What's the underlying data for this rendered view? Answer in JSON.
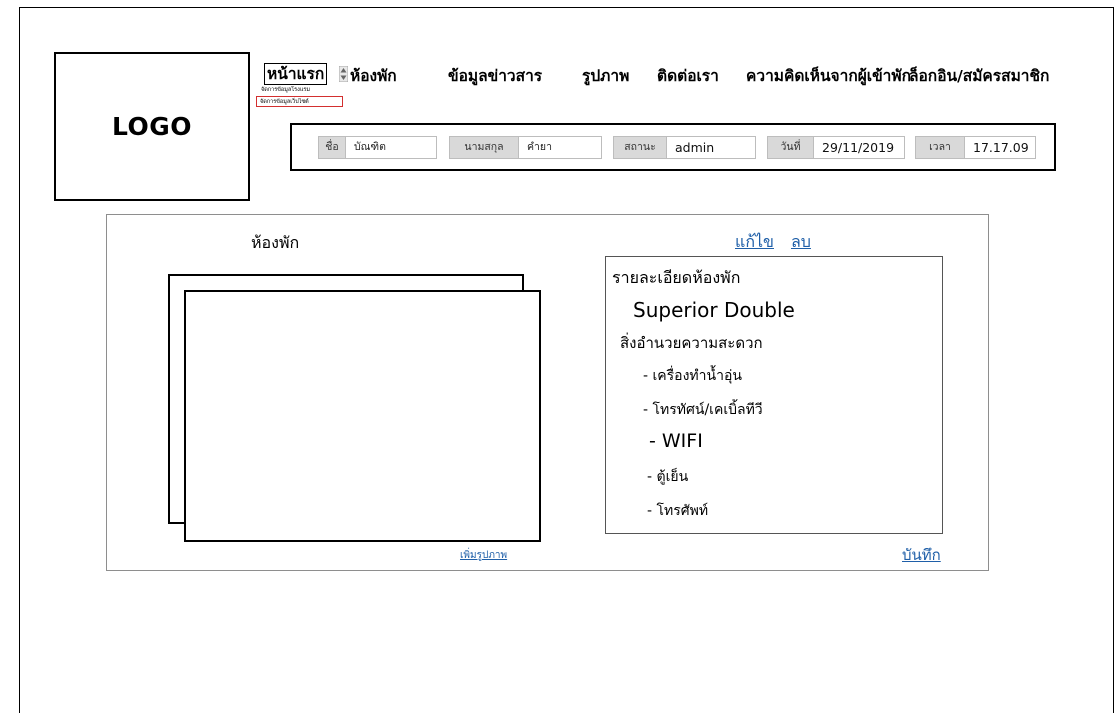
{
  "logo": {
    "text": "LOGO"
  },
  "nav": {
    "items": [
      {
        "label": "หน้าแรก"
      },
      {
        "label": "ห้องพัก"
      },
      {
        "label": "ข้อมูลข่าวสาร"
      },
      {
        "label": "รูปภาพ"
      },
      {
        "label": "ติดต่อเรา"
      },
      {
        "label": "ความคิดเห็นจากผู้เข้าพัก"
      },
      {
        "label": "ล็อกอิน/สมัครสมาชิก"
      }
    ],
    "submenu": [
      {
        "label": "จัดการข้อมูลโรงแรม",
        "highlighted": false
      },
      {
        "label": "จัดการข้อมูลเว็บไซต์",
        "highlighted": true
      }
    ],
    "highlight_color": "#d32f2f"
  },
  "userbar": {
    "name_label": "ชื่อ",
    "name_value": "บัณฑิต",
    "surname_label": "นามสกุล",
    "surname_value": "คำยา",
    "status_label": "สถานะ",
    "status_value": "admin",
    "date_label": "วันที่",
    "date_value": "29/11/2019",
    "time_label": "เวลา",
    "time_value": "17.17.09"
  },
  "room": {
    "title": "ห้องพัก",
    "edit_label": "แก้ไข",
    "delete_label": "ลบ",
    "add_photo_label": "เพิ่มรูปภาพ",
    "save_label": "บันทึก",
    "detail_heading": "รายละเอียดห้องพัก",
    "name": "Superior Double",
    "facilities_heading": "สิ่งอำนวยความสะดวก",
    "facilities": [
      "- เครื่องทำน้ำอุ่น",
      "- โทรทัศน์/เคเบิ้ลทีวี",
      "- WIFI",
      "- ตู้เย็น",
      "- โทรศัพท์"
    ]
  },
  "colors": {
    "link": "#1f5fa8",
    "field_label_bg": "#d9d9d9"
  }
}
